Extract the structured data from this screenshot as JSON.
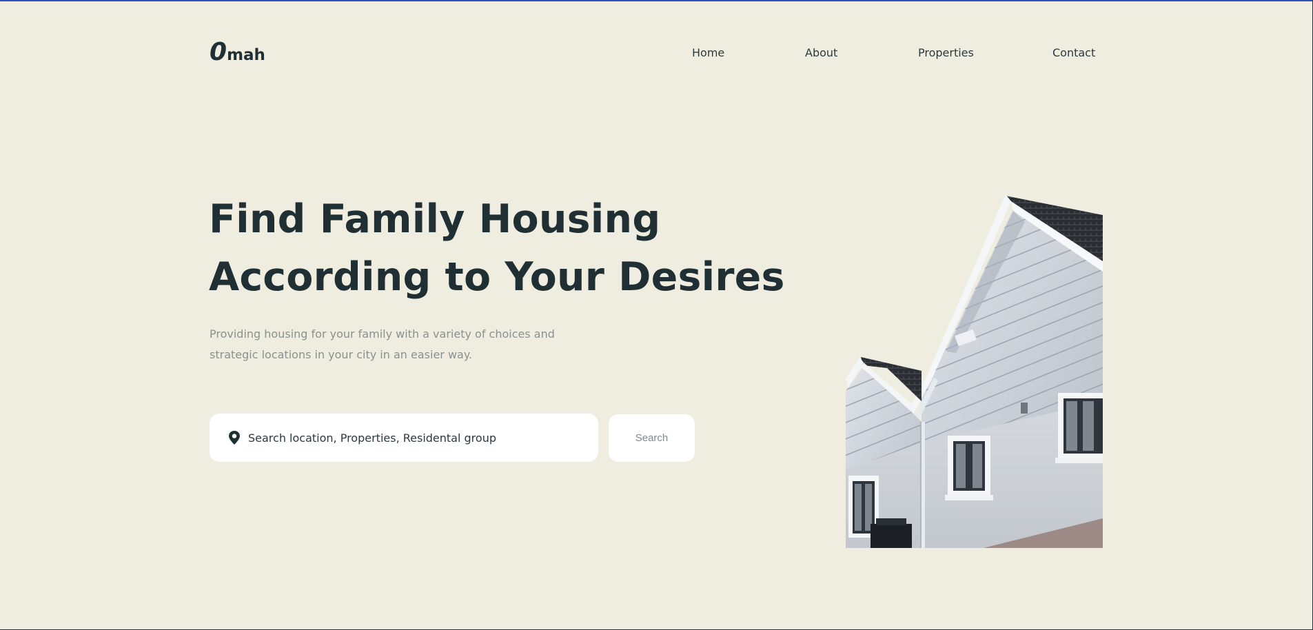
{
  "brand": {
    "logo_mark": "0",
    "logo_text": "mah"
  },
  "nav": {
    "items": [
      {
        "label": "Home"
      },
      {
        "label": "About"
      },
      {
        "label": "Properties"
      },
      {
        "label": "Contact"
      }
    ]
  },
  "hero": {
    "title_line1": "Find Family Housing",
    "title_line2": "According to Your Desires",
    "subtitle_line1": "Providing housing for your family with a variety of choices and",
    "subtitle_line2": "strategic locations in your city in an easier way."
  },
  "search": {
    "placeholder": "Search location, Properties, Residental group",
    "button_label": "Search",
    "icon": "location-pin-icon"
  },
  "colors": {
    "background": "#efede0",
    "heading": "#1f2f33",
    "muted_text": "#8a918f",
    "accent_line": "#2e4bb8"
  }
}
